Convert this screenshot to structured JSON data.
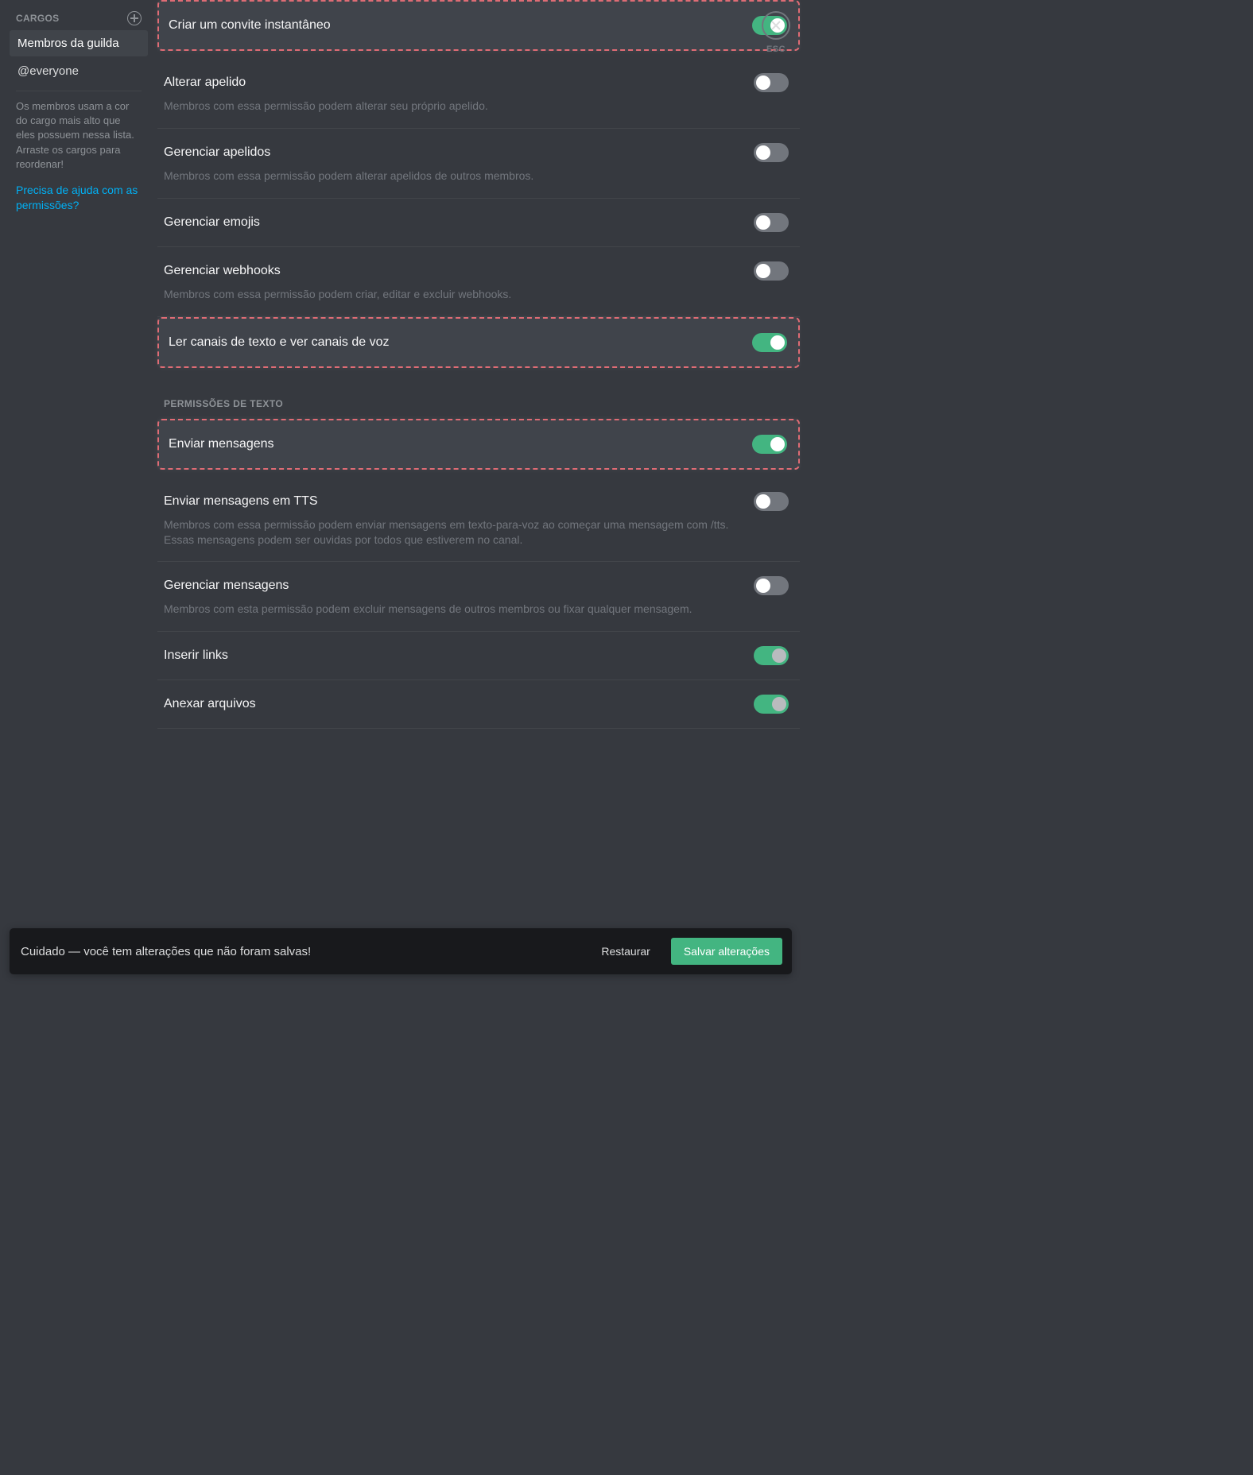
{
  "sidebar": {
    "title": "CARGOS",
    "roles": [
      {
        "label": "Membros da guilda",
        "selected": true
      },
      {
        "label": "@everyone",
        "selected": false
      }
    ],
    "note": "Os membros usam a cor do cargo mais alto que eles possuem nessa lista. Arraste os cargos para reordenar!",
    "help_link": "Precisa de ajuda com as permissões?"
  },
  "close_label": "ESC",
  "sections": [
    {
      "heading": null,
      "items": [
        {
          "id": "create-instant-invite",
          "title": "Criar um convite instantâneo",
          "desc": null,
          "on": true,
          "highlighted": true
        },
        {
          "id": "change-nickname",
          "title": "Alterar apelido",
          "desc": "Membros com essa permissão podem alterar seu próprio apelido.",
          "on": false,
          "highlighted": false
        },
        {
          "id": "manage-nicknames",
          "title": "Gerenciar apelidos",
          "desc": "Membros com essa permissão podem alterar apelidos de outros membros.",
          "on": false,
          "highlighted": false
        },
        {
          "id": "manage-emojis",
          "title": "Gerenciar emojis",
          "desc": null,
          "on": false,
          "highlighted": false
        },
        {
          "id": "manage-webhooks",
          "title": "Gerenciar webhooks",
          "desc": "Membros com essa permissão podem criar, editar e excluir webhooks.",
          "on": false,
          "highlighted": false
        },
        {
          "id": "read-text-view-voice",
          "title": "Ler canais de texto e ver canais de voz",
          "desc": null,
          "on": true,
          "highlighted": true
        }
      ]
    },
    {
      "heading": "PERMISSÕES DE TEXTO",
      "items": [
        {
          "id": "send-messages",
          "title": "Enviar mensagens",
          "desc": null,
          "on": true,
          "highlighted": true
        },
        {
          "id": "send-tts",
          "title": "Enviar mensagens em TTS",
          "desc": "Membros com essa permissão podem enviar mensagens em texto-para-voz ao começar uma mensagem com /tts. Essas mensagens podem ser ouvidas por todos que estiverem no canal.",
          "on": false,
          "highlighted": false
        },
        {
          "id": "manage-messages",
          "title": "Gerenciar mensagens",
          "desc": "Membros com esta permissão podem excluir mensagens de outros membros ou fixar qualquer mensagem.",
          "on": false,
          "highlighted": false
        },
        {
          "id": "embed-links",
          "title": "Inserir links",
          "desc": null,
          "on": true,
          "highlighted": false,
          "dim": true
        },
        {
          "id": "attach-files",
          "title": "Anexar arquivos",
          "desc": null,
          "on": true,
          "highlighted": false,
          "dim": true
        }
      ]
    }
  ],
  "save_bar": {
    "message": "Cuidado — você tem alterações que não foram salvas!",
    "reset": "Restaurar",
    "save": "Salvar alterações"
  }
}
